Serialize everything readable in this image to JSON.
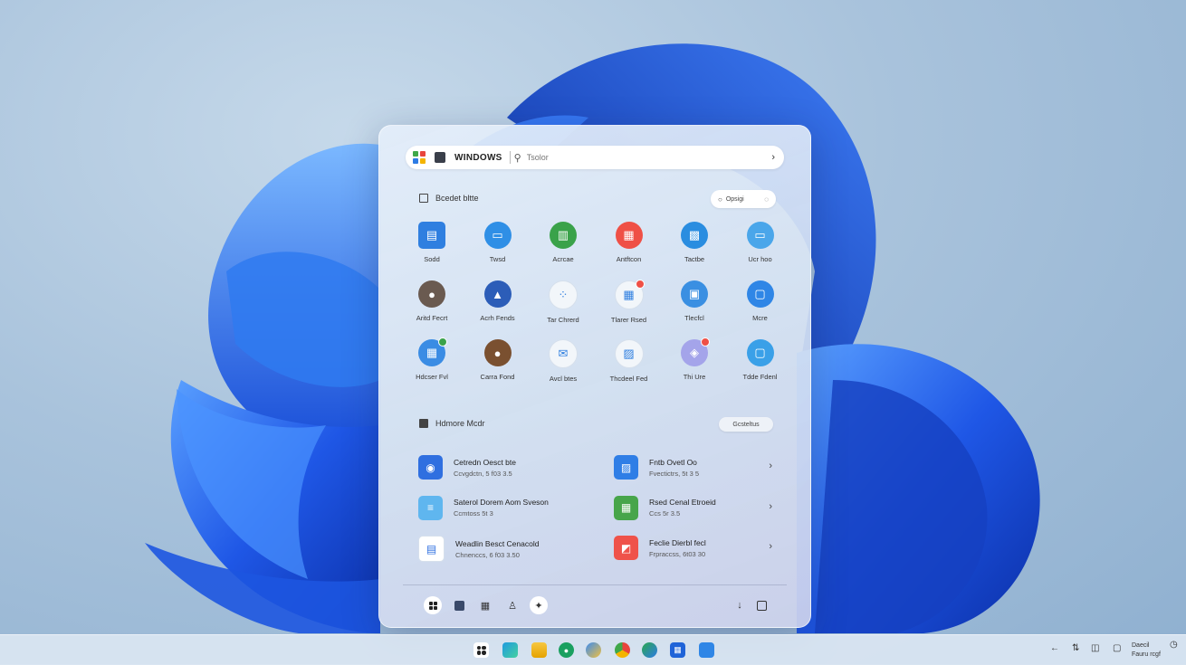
{
  "colors": {
    "accent": "#1f57e6",
    "wallpaper_bloom": "#1a4fd8"
  },
  "start_menu": {
    "search": {
      "brand": "WINDOWS",
      "placeholder": "Tsolor"
    },
    "pinned": {
      "title": "Bcedet bltte",
      "pill_label": "Opsigi",
      "apps": [
        {
          "label": "Sodd",
          "icon": "folder-blue-icon",
          "color": "#2f7fe0"
        },
        {
          "label": "Twsd",
          "icon": "folder-icon",
          "color": "#2f8fe6"
        },
        {
          "label": "Acrcae",
          "icon": "window-green-icon",
          "color": "#3aa24a"
        },
        {
          "label": "Antftcon",
          "icon": "calendar-red-icon",
          "color": "#ef5046"
        },
        {
          "label": "Tactbe",
          "icon": "chart-icon",
          "color": "#2a8de0"
        },
        {
          "label": "Ucr hoo",
          "icon": "monitor-icon",
          "color": "#4aa6ea"
        },
        {
          "label": "Aritd Fecrt",
          "icon": "avatar-icon",
          "color": "#6a5a50"
        },
        {
          "label": "Acrh Fends",
          "icon": "mountain-icon",
          "color": "#2c5db8"
        },
        {
          "label": "Tar Chrerd",
          "icon": "dots-icon",
          "color": "#f2f6fa"
        },
        {
          "label": "Tlarer Rsed",
          "icon": "calendar-badge-icon",
          "color": "#f2f6fa"
        },
        {
          "label": "Tlecfcl",
          "icon": "window-blue-icon",
          "color": "#3a8fe2"
        },
        {
          "label": "Mcre",
          "icon": "square-blue-icon",
          "color": "#2f86e6"
        },
        {
          "label": "Hdcser Fvl",
          "icon": "grid-badge-icon",
          "color": "#3a8ce4"
        },
        {
          "label": "Carra Fond",
          "icon": "avatar-photo-icon",
          "color": "#7a5030"
        },
        {
          "label": "Avcl btes",
          "icon": "mail-icon",
          "color": "#f2f6fa"
        },
        {
          "label": "Thcdeel Fed",
          "icon": "photo-icon",
          "color": "#f2f6fa"
        },
        {
          "label": "Thi Ure",
          "icon": "copilot-icon",
          "color": "#a4a4ea"
        },
        {
          "label": "Tdde Fdenl",
          "icon": "square-outline-icon",
          "color": "#3aa0e8"
        }
      ]
    },
    "recommended": {
      "title": "Hdmore Mcdr",
      "pill_label": "Gcsteltus",
      "items": [
        {
          "title": "Cetredn Oesct bte",
          "subtitle": "Ccvgdctn, 5 f03 3.5",
          "icon": "people-icon",
          "color": "#2f6fe0"
        },
        {
          "title": "Fntb Ovetl Oo",
          "subtitle": "Fvectictrs, 5t 3 5",
          "icon": "image-icon",
          "color": "#2f7ee6"
        },
        {
          "title": "Saterol Dorem Aom Sveson",
          "subtitle": "Ccmtoss 5t 3",
          "icon": "doc-icon",
          "color": "#5fb6ef"
        },
        {
          "title": "Rsed Cenal Etroeid",
          "subtitle": "Ccs 5r 3.5",
          "icon": "sheet-icon",
          "color": "#47a54a"
        },
        {
          "title": "Weadlin Besct Cenacold",
          "subtitle": "Chnenccs, 6 f03 3.50",
          "icon": "files-icon",
          "color": "#ffffff"
        },
        {
          "title": "Feclie Dierbl fecl",
          "subtitle": "Frpraccss, 6t03 30",
          "icon": "ppt-icon",
          "color": "#ef524a"
        }
      ]
    },
    "footer_icons": [
      "start-icon",
      "photo-icon",
      "calendar-icon",
      "person-icon",
      "star-icon",
      "download-icon",
      "power-icon"
    ]
  },
  "taskbar": {
    "icons": [
      "start-icon",
      "widgets-icon",
      "files-icon",
      "shield-icon",
      "browser-icon",
      "chrome-icon",
      "globe-icon",
      "store-icon",
      "app-icon"
    ],
    "clock": {
      "line1": "Daecil",
      "line2": "Fauru rcgf"
    }
  }
}
